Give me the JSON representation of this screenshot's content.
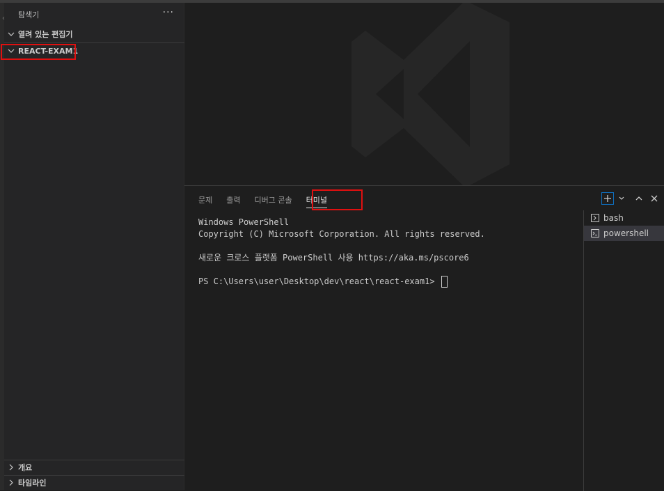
{
  "sidebar": {
    "title": "탐색기",
    "more": "···",
    "open_editors": "열려 있는 편집기",
    "project": "REACT-EXAM1",
    "outline": "개요",
    "timeline": "타임라인"
  },
  "panel": {
    "tabs": [
      {
        "label": "문제"
      },
      {
        "label": "출력"
      },
      {
        "label": "디버그 콘솔"
      },
      {
        "label": "터미널",
        "active": true
      }
    ]
  },
  "terminal": {
    "lines": [
      "Windows PowerShell",
      "Copyright (C) Microsoft Corporation. All rights reserved.",
      "",
      "새로운 크로스 플랫폼 PowerShell 사용 https://aka.ms/pscore6",
      ""
    ],
    "prompt": "PS C:\\Users\\user\\Desktop\\dev\\react\\react-exam1> "
  },
  "terminals_list": [
    {
      "label": "bash",
      "icon": "bash-terminal-icon"
    },
    {
      "label": "powershell",
      "icon": "powershell-icon",
      "selected": true
    }
  ],
  "colors": {
    "highlight": "#e01010",
    "accent": "#0e70c0"
  }
}
